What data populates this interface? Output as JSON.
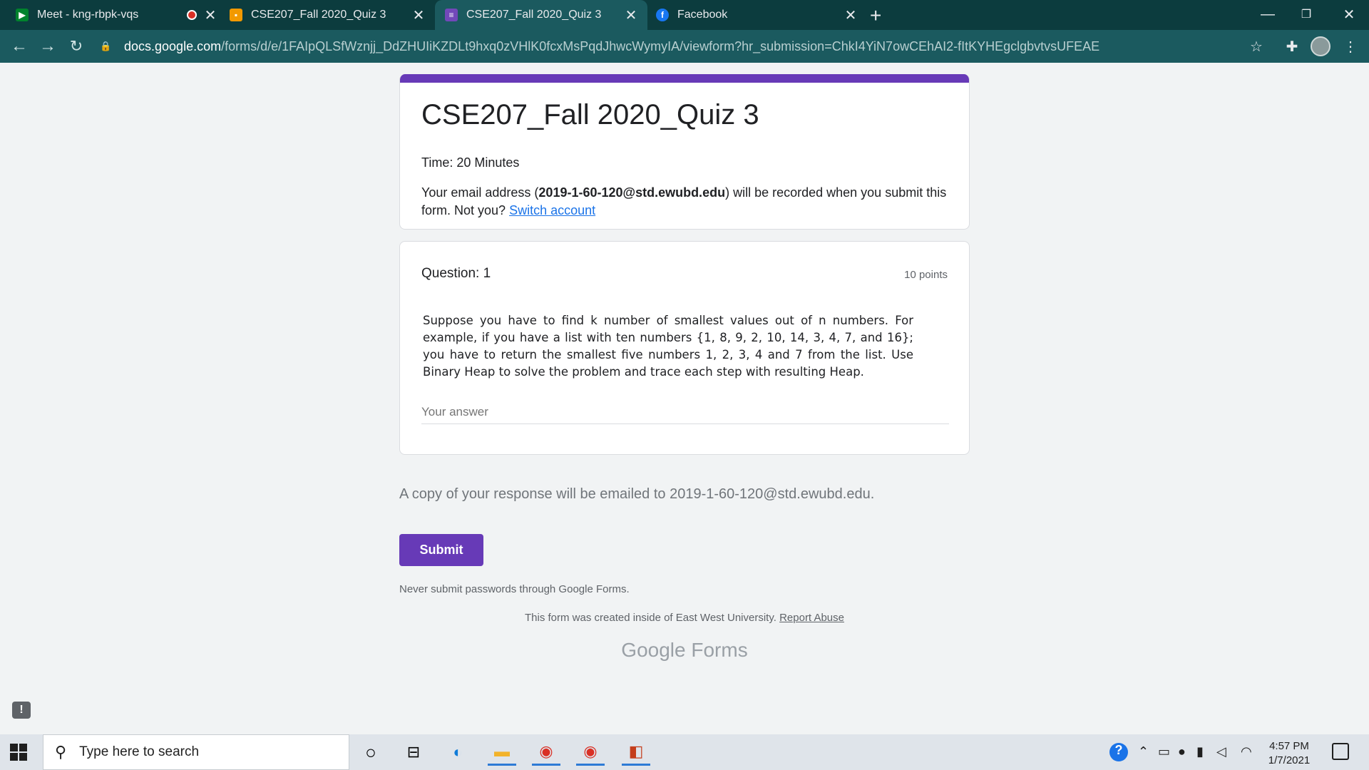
{
  "browser": {
    "tabs": [
      {
        "title": "Meet - kng-rbpk-vqs",
        "icon": "meet-icon",
        "recording": true
      },
      {
        "title": "CSE207_Fall 2020_Quiz 3",
        "icon": "slides-icon"
      },
      {
        "title": "CSE207_Fall 2020_Quiz 3",
        "icon": "forms-icon",
        "active": true
      },
      {
        "title": "Facebook",
        "icon": "facebook-icon"
      }
    ],
    "url_host": "docs.google.com",
    "url_path": "/forms/d/e/1FAIpQLSfWznjj_DdZHUIiKZDLt9hxq0zVHlK0fcxMsPqdJhwcWymyIA/viewform?hr_submission=ChkI4YiN7owCEhAI2-fItKYHEgclgbvtvsUFEAE"
  },
  "form": {
    "title": "CSE207_Fall 2020_Quiz 3",
    "description": "Time: 20 Minutes",
    "email_prefix": "Your email address (",
    "email": "2019-1-60-120@std.ewubd.edu",
    "email_suffix": ") will be recorded when you submit this form. Not you?",
    "switch_account": "Switch account",
    "question": {
      "title": "Question: 1",
      "points": "10 points",
      "body": "Suppose you have to find k number of smallest values out of n numbers. For example, if you have a list with ten numbers {1, 8, 9, 2, 10, 14, 3, 4, 7, and 16}; you have to return the smallest five numbers 1, 2, 3, 4 and 7 from the list. Use Binary Heap to solve the problem and trace each step with resulting Heap.",
      "answer_placeholder": "Your answer"
    },
    "copy_note": "A copy of your response will be emailed to 2019-1-60-120@std.ewubd.edu.",
    "submit_label": "Submit",
    "never_submit": "Never submit passwords through Google Forms.",
    "created_text": "This form was created inside of East West University.",
    "report_abuse": "Report Abuse",
    "brand_google": "Google",
    "brand_forms": "Forms"
  },
  "taskbar": {
    "search_placeholder": "Type here to search",
    "time": "4:57 PM",
    "date": "1/7/2021"
  },
  "colors": {
    "accent": "#673ab7",
    "browser_frame": "#0c3c3e",
    "toolbar": "#1b5a5f"
  }
}
